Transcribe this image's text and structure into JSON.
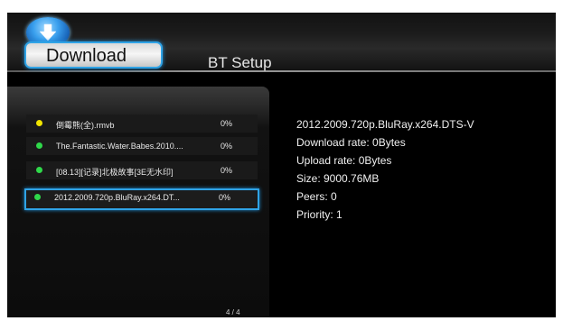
{
  "header": {
    "tabs": [
      {
        "label": "Download",
        "active": true
      },
      {
        "label": "BT Setup",
        "active": false
      }
    ],
    "logo_icon": "download-arrow-icon"
  },
  "task_list": {
    "items": [
      {
        "name": "倒霉熊(全).rmvb",
        "progress": "0%",
        "status_color": "#f2e500"
      },
      {
        "name": "The.Fantastic.Water.Babes.2010....",
        "progress": "0%",
        "status_color": "#2fd84a"
      },
      {
        "name": "[08.13][记录]北极故事[3E无水印]",
        "progress": "0%",
        "status_color": "#2fd84a"
      },
      {
        "name": "2012.2009.720p.BluRay.x264.DT...",
        "progress": "0%",
        "status_color": "#2fd84a",
        "selected": true
      }
    ],
    "page_indicator": "4 / 4"
  },
  "details": {
    "title": "2012.2009.720p.BluRay.x264.DTS-V",
    "download_rate": "Download rate: 0Bytes",
    "upload_rate": "Upload rate: 0Bytes",
    "size": "Size: 9000.76MB",
    "peers": "Peers: 0",
    "priority": "Priority: 1"
  },
  "colors": {
    "accent": "#2fa3e6",
    "background": "#000000",
    "text": "#f0f0f0"
  }
}
